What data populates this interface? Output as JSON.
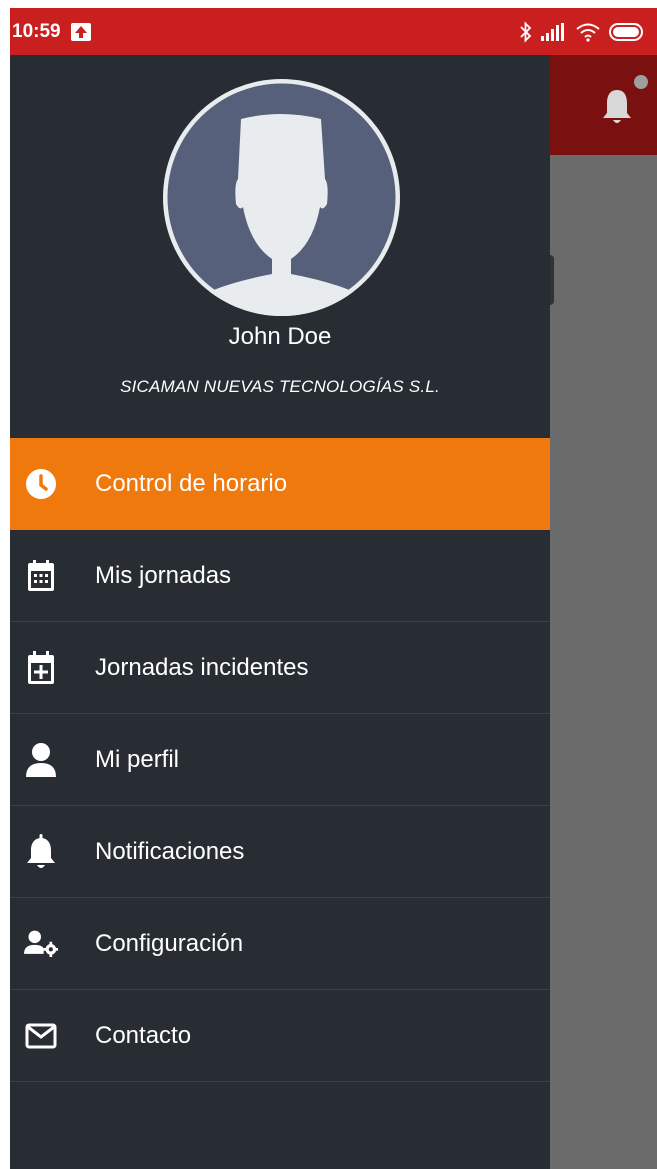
{
  "status_bar": {
    "time": "10:59",
    "icons": [
      "upload-icon",
      "bluetooth-icon",
      "signal-icon",
      "wifi-icon",
      "battery-icon"
    ]
  },
  "background_app": {
    "toolbar_color": "#7a1010",
    "icons": [
      "bell-icon"
    ]
  },
  "drawer": {
    "user": {
      "name": "John Doe",
      "company": "SICAMAN NUEVAS TECNOLOGÍAS S.L."
    },
    "menu": [
      {
        "label": "Control de horario",
        "icon": "clock-icon",
        "active": true
      },
      {
        "label": "Mis jornadas",
        "icon": "calendar-grid-icon",
        "active": false
      },
      {
        "label": "Jornadas incidentes",
        "icon": "calendar-plus-icon",
        "active": false
      },
      {
        "label": "Mi perfil",
        "icon": "user-icon",
        "active": false
      },
      {
        "label": "Notificaciones",
        "icon": "bell-icon",
        "active": false
      },
      {
        "label": "Configuración",
        "icon": "user-gear-icon",
        "active": false
      },
      {
        "label": "Contacto",
        "icon": "envelope-icon",
        "active": false
      }
    ]
  },
  "colors": {
    "status_bar": "#c91f1f",
    "drawer_bg": "#282c33",
    "active_item": "#f0790e",
    "avatar_bg": "#56607a"
  }
}
